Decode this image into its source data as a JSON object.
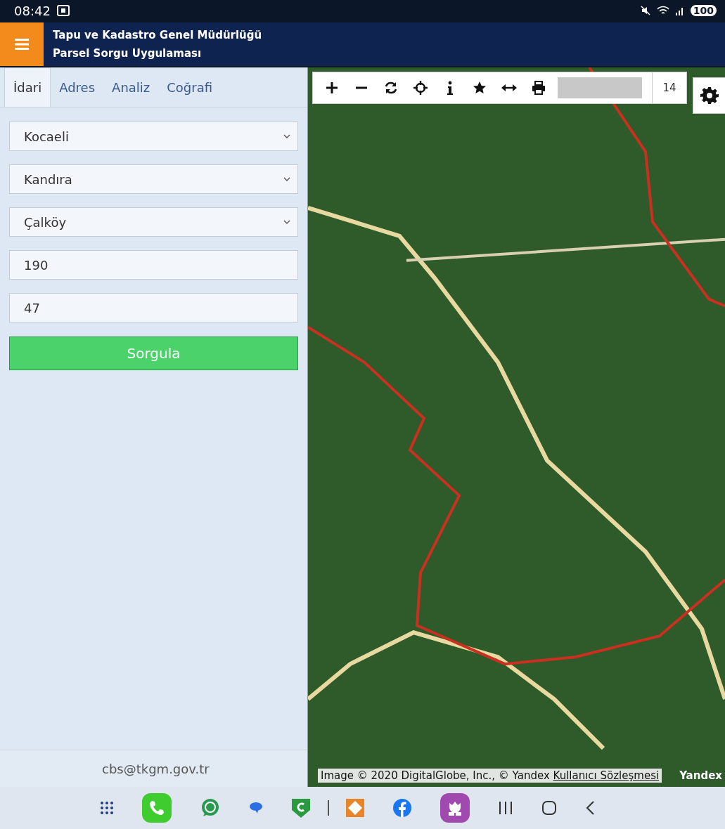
{
  "status_bar": {
    "time": "08:42",
    "battery": "100"
  },
  "header": {
    "title": "Tapu ve Kadastro Genel Müdürlüğü",
    "subtitle": "Parsel Sorgu Uygulaması"
  },
  "tabs": [
    {
      "label": "İdari",
      "selected": true
    },
    {
      "label": "Adres",
      "selected": false
    },
    {
      "label": "Analiz",
      "selected": false
    },
    {
      "label": "Coğrafi",
      "selected": false
    }
  ],
  "fields": [
    {
      "kind": "select",
      "value": "Kocaeli"
    },
    {
      "kind": "select",
      "value": "Kandıra"
    },
    {
      "kind": "select",
      "value": "Çalköy"
    },
    {
      "kind": "input",
      "value": "190"
    },
    {
      "kind": "input",
      "value": "47"
    }
  ],
  "query_button": "Sorgula",
  "footer_email": "cbs@tkgm.gov.tr",
  "map": {
    "zoom_level": "14",
    "attribution": "Image © 2020 DigitalGlobe, Inc., © Yandex",
    "attribution_link": "Kullanıcı Sözleşmesi",
    "provider": "Yandex"
  }
}
